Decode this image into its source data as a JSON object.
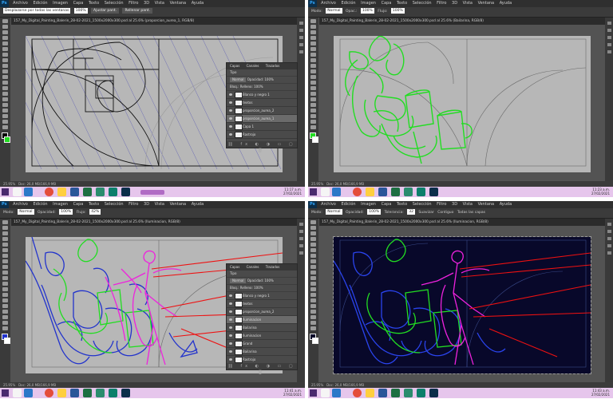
{
  "app": {
    "ps_badge": "Ps",
    "menu_items": [
      "Archivo",
      "Edición",
      "Imagen",
      "Capa",
      "Texto",
      "Selección",
      "Filtro",
      "3D",
      "Vista",
      "Ventana",
      "Ayuda"
    ]
  },
  "quadrants": [
    {
      "options": {
        "tool_option": "Desplazarse por todas las ventanas",
        "zoom": "100%",
        "fit_button": "Ajustar pant.",
        "fill_button": "Rellenar pant."
      },
      "doc_tab": "157_My_Digital_Painting_Balerin_28-02-2021_1500x2000x300.psd al 25.6% (proporcion_aurea_1, RGB/8)",
      "zoom_status": "25.95%",
      "doc_status": "Doc: 26,0 MB/166,9 MB",
      "time": "11:17 a.m.",
      "date": "27/02/2021",
      "layers_panel": {
        "tabs": [
          "Capas",
          "Canales",
          "Trazados"
        ],
        "kind": "Tipo",
        "blend": "Normal",
        "opacity_label": "Opacidad:",
        "opacity": "100%",
        "lock_label": "Bloq.:",
        "fill_label": "Relleno:",
        "fill": "100%",
        "layers": [
          "Blanco y negro 1",
          "textos",
          "proporcion_aurea_2",
          "proporcion_aurea_1",
          "Capa 1",
          "Rastrojo"
        ],
        "active_index": 3
      }
    },
    {
      "options": {
        "tool_option": "Modo:",
        "mode": "Normal",
        "opacity_label": "Opac.:",
        "opacity": "100%",
        "flow_label": "Flujo:",
        "flow": "100%"
      },
      "doc_tab": "157_My_Digital_Painting_Balerin_28-02-2021_1500x2000x300.psd al 25.6% (Bailarina, RGB/8)",
      "zoom_status": "25.95%",
      "doc_status": "Doc: 26,0 MB/166,9 MB",
      "time": "11:23 a.m.",
      "date": "27/02/2021"
    },
    {
      "options": {
        "tool_option": "Modo:",
        "mode": "Normal",
        "opacity_label": "Opacidad:",
        "opacity": "100%",
        "flow_label": "Flujo:",
        "flow": "42%"
      },
      "doc_tab": "157_My_Digital_Painting_Balerin_28-02-2021_1500x2000x300.psd al 25.6% (Iluminacion, RGB/8)",
      "zoom_status": "25.95%",
      "doc_status": "Doc: 26,0 MB/166,9 MB",
      "time": "11:41 a.m.",
      "date": "27/02/2021",
      "layers_panel": {
        "tabs": [
          "Capas",
          "Canales",
          "Trazados"
        ],
        "kind": "Tipo",
        "blend": "Normal",
        "opacity_label": "Opacidad:",
        "opacity": "100%",
        "lock_label": "Bloq.:",
        "fill_label": "Relleno:",
        "fill": "100%",
        "layers": [
          "Blanco y negro 1",
          "textos",
          "proporcion_aurea_2",
          "Iluminacion",
          "Bailarina",
          "Iluminacion",
          "Grand",
          "Bailarina",
          "Rastrojo"
        ],
        "active_index": 3
      }
    },
    {
      "options": {
        "tool_option": "Modo:",
        "mode": "Normal",
        "opacity_label": "Opacidad:",
        "opacity": "100%",
        "tol_label": "Tolerancia:",
        "tol": "32",
        "antialias": "Suavizar",
        "contiguous": "Contiguo",
        "all_layers": "Todas las capas"
      },
      "doc_tab": "157_My_Digital_Painting_Balerin_28-02-2021_1500x2000x300.psd al 25.6% (Iluminacion, RGB/8)",
      "zoom_status": "25.95%",
      "doc_status": "Doc: 26,0 MB/166,9 MB",
      "time": "11:43 a.m.",
      "date": "27/02/2021"
    }
  ],
  "colors": {
    "canvas_gray": "#b7b7b7",
    "canvas_dark": "#08082a",
    "sketch_green": "#22dd22",
    "sketch_blue": "#2233cc",
    "sketch_magenta": "#ee22dd",
    "sketch_red": "#ee1111",
    "taskbar": "#e6c6ec"
  }
}
